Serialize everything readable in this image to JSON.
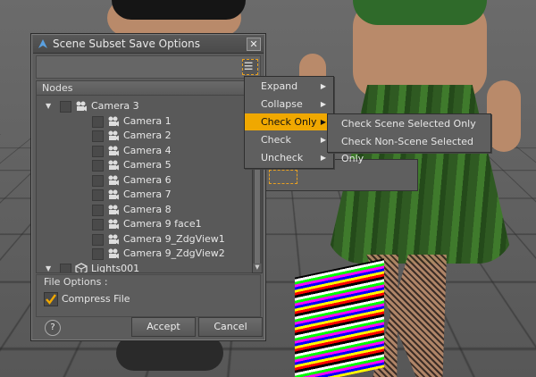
{
  "dialog": {
    "title": "Scene Subset Save Options",
    "close_symbol": "✕",
    "nodes_header": "Nodes",
    "tree": [
      {
        "label": "Camera 3",
        "level": 0,
        "expanded": true,
        "icon": "camera-icon"
      },
      {
        "label": "Camera 1",
        "level": 1,
        "icon": "camera-icon"
      },
      {
        "label": "Camera 2",
        "level": 1,
        "icon": "camera-icon"
      },
      {
        "label": "Camera 4",
        "level": 1,
        "icon": "camera-icon"
      },
      {
        "label": "Camera 5",
        "level": 1,
        "icon": "camera-icon"
      },
      {
        "label": "Camera 6",
        "level": 1,
        "icon": "camera-icon"
      },
      {
        "label": "Camera 7",
        "level": 1,
        "icon": "camera-icon"
      },
      {
        "label": "Camera 8",
        "level": 1,
        "icon": "camera-icon"
      },
      {
        "label": "Camera 9 face1",
        "level": 1,
        "icon": "camera-icon"
      },
      {
        "label": "Camera 9_ZdgView1",
        "level": 1,
        "icon": "camera-icon"
      },
      {
        "label": "Camera 9_ZdgView2",
        "level": 1,
        "icon": "camera-icon"
      },
      {
        "label": "Lights001",
        "level": 0,
        "expanded": true,
        "icon": "light-group-icon"
      }
    ],
    "file_options_label": "File Options :",
    "compress_file_label": "Compress File",
    "compress_file_checked": true,
    "help_symbol": "?",
    "accept_label": "Accept",
    "cancel_label": "Cancel"
  },
  "context_menu": {
    "items": [
      {
        "label": "Expand",
        "has_submenu": true,
        "selected": false
      },
      {
        "label": "Collapse",
        "has_submenu": true,
        "selected": false
      },
      {
        "label": "Check Only",
        "has_submenu": true,
        "selected": true
      },
      {
        "label": "Check",
        "has_submenu": true,
        "selected": false
      },
      {
        "label": "Uncheck",
        "has_submenu": true,
        "selected": false
      }
    ],
    "submenu_arrow": "▶"
  },
  "submenu": {
    "items": [
      {
        "label": "Check Scene Selected Only"
      },
      {
        "label": "Check Non-Scene Selected Only"
      }
    ]
  },
  "colors": {
    "highlight": "#f0a800",
    "dialog_bg": "#5c5c5c"
  }
}
